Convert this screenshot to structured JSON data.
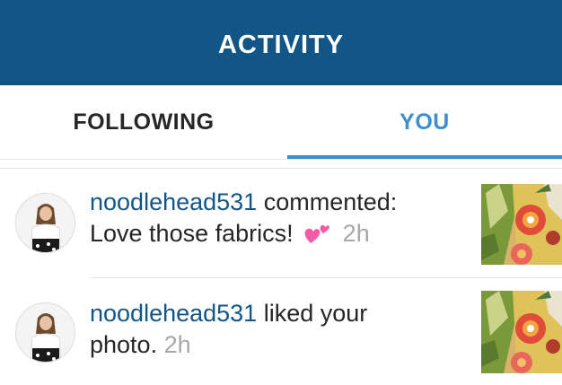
{
  "header": {
    "title": "ACTIVITY"
  },
  "tabs": [
    {
      "label": "FOLLOWING",
      "active": false
    },
    {
      "label": "YOU",
      "active": true
    }
  ],
  "colors": {
    "header_bg": "#125688",
    "active_tab": "#3f8fcf",
    "username": "#125688",
    "timestamp": "#a8a8a8"
  },
  "activity": [
    {
      "username": "noodlehead531",
      "action": " commented:",
      "comment": "Love those fabrics!",
      "emoji": "two-hearts-emoji",
      "time": "2h",
      "avatar_icon": "user-avatar",
      "thumbnail_icon": "fabric-photo-thumbnail"
    },
    {
      "username": "noodlehead531",
      "action": " liked your",
      "comment": "photo.",
      "time": "2h",
      "avatar_icon": "user-avatar",
      "thumbnail_icon": "fabric-photo-thumbnail"
    }
  ]
}
